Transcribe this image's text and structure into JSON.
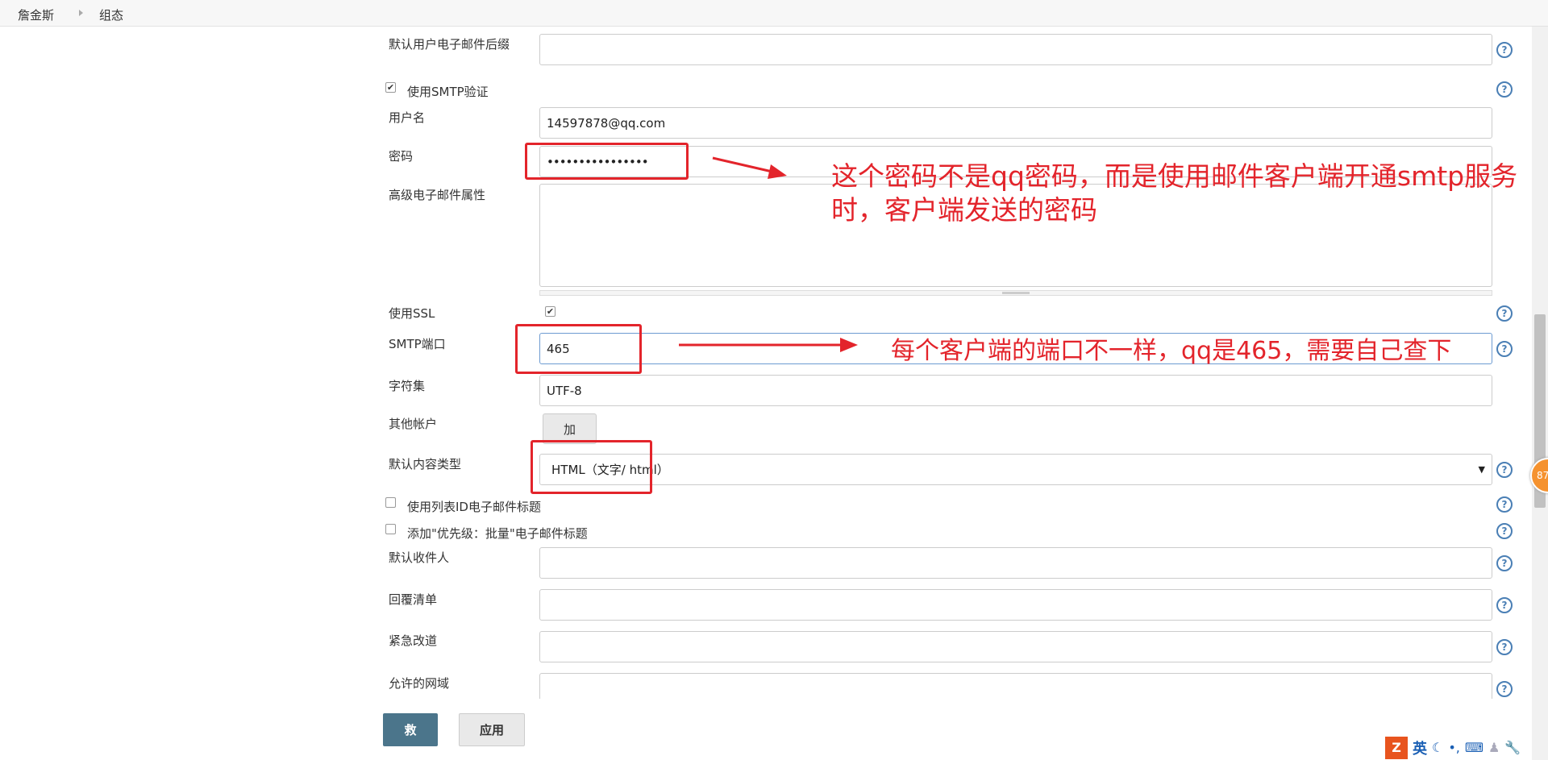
{
  "breadcrumb": {
    "home": "詹金斯",
    "current": "组态"
  },
  "form": {
    "default_suffix": {
      "label": "默认用户电子邮件后缀",
      "value": ""
    },
    "smtp_auth": {
      "label": "使用SMTP验证",
      "checked": true
    },
    "username": {
      "label": "用户名",
      "value": "14597878@qq.com"
    },
    "password": {
      "label": "密码",
      "value": "••••••••••••••••"
    },
    "advanced": {
      "label": "高级电子邮件属性",
      "value": ""
    },
    "ssl": {
      "label": "使用SSL",
      "checked": true
    },
    "smtp_port": {
      "label": "SMTP端口",
      "value": "465"
    },
    "charset": {
      "label": "字符集",
      "value": "UTF-8"
    },
    "other_accounts": {
      "label": "其他帐户",
      "button": "加"
    },
    "content_type": {
      "label": "默认内容类型",
      "value": "HTML（文字/ html）"
    },
    "list_id": {
      "label": "使用列表ID电子邮件标题",
      "checked": false
    },
    "priority": {
      "label": "添加\"优先级：批量\"电子邮件标题",
      "checked": false
    },
    "recipients": {
      "label": "默认收件人",
      "value": ""
    },
    "reply_to": {
      "label": "回覆清单",
      "value": ""
    },
    "emergency": {
      "label": "紧急改道",
      "value": ""
    },
    "allowed_domains": {
      "label": "允许的网域",
      "value": ""
    }
  },
  "buttons": {
    "save": "救",
    "apply": "应用"
  },
  "annotations": {
    "password_note_line1": "这个密码不是qq密码，而是使用邮件客户端开通smtp服务",
    "password_note_line2": "时，客户端发送的密码",
    "port_note": "每个客户端的端口不一样，qq是465，需要自己查下"
  },
  "help_icon_text": "?",
  "badge": {
    "text": "87"
  },
  "tray": {
    "ime_label": "英"
  },
  "colors": {
    "annotation": "#e3242b",
    "save_button": "#4b758b",
    "help": "#4a7fb5"
  }
}
